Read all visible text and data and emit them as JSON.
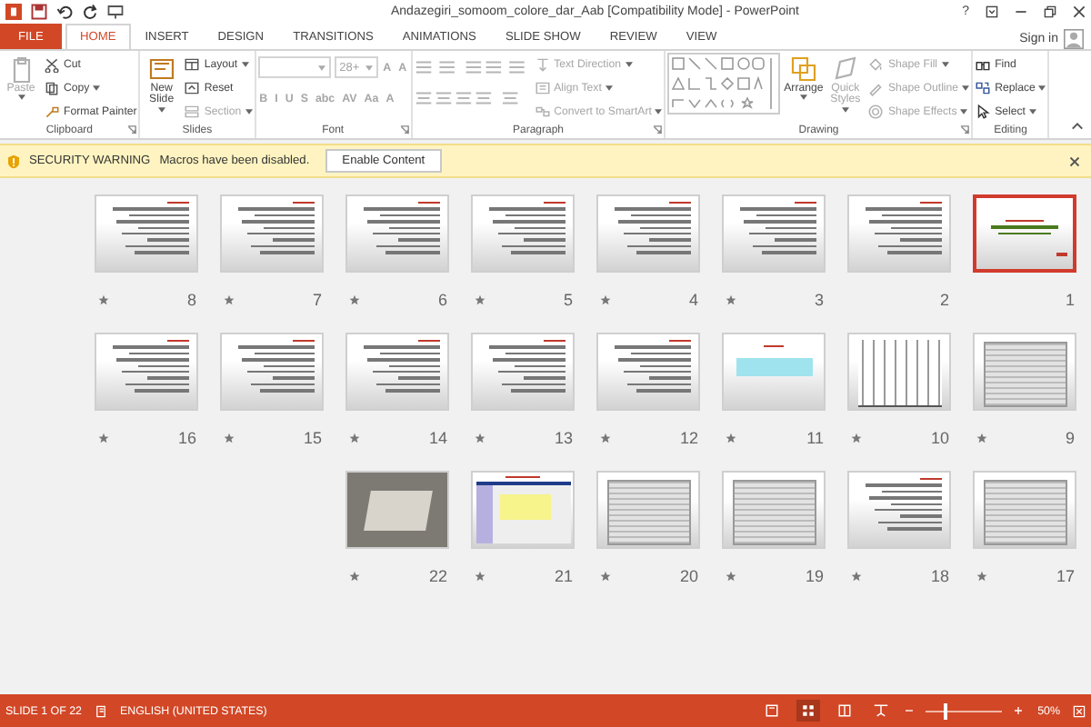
{
  "window": {
    "title": "Andazegiri_somoom_colore_dar_Aab [Compatibility Mode] - PowerPoint",
    "help": "?"
  },
  "tabs": [
    {
      "label": "FILE",
      "kind": "file",
      "selected": false
    },
    {
      "label": "HOME",
      "kind": "tab",
      "selected": true
    },
    {
      "label": "INSERT",
      "kind": "tab",
      "selected": false
    },
    {
      "label": "DESIGN",
      "kind": "tab",
      "selected": false
    },
    {
      "label": "TRANSITIONS",
      "kind": "tab",
      "selected": false
    },
    {
      "label": "ANIMATIONS",
      "kind": "tab",
      "selected": false
    },
    {
      "label": "SLIDE SHOW",
      "kind": "tab",
      "selected": false
    },
    {
      "label": "REVIEW",
      "kind": "tab",
      "selected": false
    },
    {
      "label": "VIEW",
      "kind": "tab",
      "selected": false
    }
  ],
  "account": {
    "label": "Sign in"
  },
  "ribbon": {
    "groups": [
      {
        "label": "Clipboard",
        "launcher": true,
        "columns": [
          [
            {
              "kind": "large",
              "label": "Paste",
              "disabled": true,
              "dropdown": true
            }
          ],
          [
            {
              "kind": "small",
              "label": "Cut",
              "disabled": false,
              "dropdown": false
            },
            {
              "kind": "small",
              "label": "Copy",
              "disabled": false,
              "dropdown": true
            },
            {
              "kind": "small",
              "label": "Format Painter",
              "disabled": false,
              "dropdown": false
            }
          ]
        ]
      },
      {
        "label": "Slides",
        "launcher": false,
        "columns": [
          [
            {
              "kind": "large",
              "label": "New Slide",
              "disabled": false,
              "dropdown": true
            }
          ],
          [
            {
              "kind": "small",
              "label": "Layout",
              "disabled": false,
              "dropdown": true
            },
            {
              "kind": "small",
              "label": "Reset",
              "disabled": false,
              "dropdown": false
            },
            {
              "kind": "small",
              "label": "Section",
              "disabled": true,
              "dropdown": true
            }
          ]
        ]
      },
      {
        "label": "Font",
        "launcher": true,
        "columns": [
          [
            {
              "kind": "row",
              "items": [
                {
                  "kind": "combo",
                  "disabled": true,
                  "dropdown": true
                },
                {
                  "kind": "combo",
                  "value": "28+",
                  "disabled": true,
                  "dropdown": true
                },
                {
                  "kind": "glyph",
                  "label": "A",
                  "disabled": true
                },
                {
                  "kind": "glyph",
                  "label": "A",
                  "disabled": true
                }
              ]
            },
            {
              "kind": "row",
              "items": [
                {
                  "kind": "glyph",
                  "label": "B",
                  "disabled": true
                },
                {
                  "kind": "glyph",
                  "label": "I",
                  "disabled": true
                },
                {
                  "kind": "glyph",
                  "label": "U",
                  "disabled": true
                },
                {
                  "kind": "glyph",
                  "label": "S",
                  "disabled": true
                },
                {
                  "kind": "glyph",
                  "label": "abc",
                  "disabled": true
                },
                {
                  "kind": "glyph",
                  "label": "AV",
                  "disabled": true
                },
                {
                  "kind": "glyph",
                  "label": "Aa",
                  "disabled": true
                },
                {
                  "kind": "glyph",
                  "label": "A",
                  "disabled": true
                }
              ]
            }
          ]
        ]
      },
      {
        "label": "Paragraph",
        "launcher": true,
        "columns": [
          [
            {
              "kind": "listbuttons",
              "disabled": true
            },
            {
              "kind": "alignbuttons",
              "disabled": true
            }
          ],
          [
            {
              "kind": "small",
              "label": "Text Direction",
              "disabled": true,
              "dropdown": true
            },
            {
              "kind": "small",
              "label": "Align Text",
              "disabled": true,
              "dropdown": true
            },
            {
              "kind": "small",
              "label": "Convert to SmartArt",
              "disabled": true,
              "dropdown": true
            }
          ]
        ]
      },
      {
        "label": "Drawing",
        "launcher": true,
        "columns": [
          [
            {
              "kind": "shapes",
              "disabled": true
            }
          ],
          [
            {
              "kind": "large",
              "label": "Arrange",
              "disabled": false,
              "dropdown": true
            }
          ],
          [
            {
              "kind": "large",
              "label": "Quick Styles",
              "disabled": true,
              "dropdown": true
            }
          ],
          [
            {
              "kind": "small",
              "label": "Shape Fill",
              "disabled": true,
              "dropdown": true
            },
            {
              "kind": "small",
              "label": "Shape Outline",
              "disabled": true,
              "dropdown": true
            },
            {
              "kind": "small",
              "label": "Shape Effects",
              "disabled": true,
              "dropdown": true
            }
          ]
        ]
      },
      {
        "label": "Editing",
        "launcher": false,
        "columns": [
          [
            {
              "kind": "small",
              "label": "Find",
              "disabled": false,
              "dropdown": false
            },
            {
              "kind": "small",
              "label": "Replace",
              "disabled": false,
              "dropdown": true
            },
            {
              "kind": "small",
              "label": "Select",
              "disabled": false,
              "dropdown": true
            }
          ]
        ]
      }
    ]
  },
  "security_bar": {
    "title": "SECURITY WARNING",
    "message": "Macros have been disabled.",
    "button": "Enable Content"
  },
  "slide_rows": [
    [
      {
        "number": "8",
        "kind": "text",
        "selected": false,
        "transition": true
      },
      {
        "number": "7",
        "kind": "text",
        "selected": false,
        "transition": true
      },
      {
        "number": "6",
        "kind": "text",
        "selected": false,
        "transition": true
      },
      {
        "number": "5",
        "kind": "text",
        "selected": false,
        "transition": true
      },
      {
        "number": "4",
        "kind": "text",
        "selected": false,
        "transition": true
      },
      {
        "number": "3",
        "kind": "text",
        "selected": false,
        "transition": true
      },
      {
        "number": "2",
        "kind": "text",
        "selected": false,
        "transition": false
      },
      {
        "number": "1",
        "kind": "title",
        "selected": true,
        "transition": false
      }
    ],
    [
      {
        "number": "16",
        "kind": "text",
        "selected": false,
        "transition": true
      },
      {
        "number": "15",
        "kind": "text",
        "selected": false,
        "transition": true
      },
      {
        "number": "14",
        "kind": "text",
        "selected": false,
        "transition": true
      },
      {
        "number": "13",
        "kind": "text",
        "selected": false,
        "transition": true
      },
      {
        "number": "12",
        "kind": "text",
        "selected": false,
        "transition": true
      },
      {
        "number": "11",
        "kind": "equation",
        "selected": false,
        "transition": true
      },
      {
        "number": "10",
        "kind": "chart",
        "selected": false,
        "transition": true
      },
      {
        "number": "9",
        "kind": "table",
        "selected": false,
        "transition": true
      }
    ],
    [
      {
        "number": "22",
        "kind": "photo",
        "selected": false,
        "transition": true
      },
      {
        "number": "21",
        "kind": "screenshot",
        "selected": false,
        "transition": true
      },
      {
        "number": "20",
        "kind": "table",
        "selected": false,
        "transition": true
      },
      {
        "number": "19",
        "kind": "table",
        "selected": false,
        "transition": true
      },
      {
        "number": "18",
        "kind": "text",
        "selected": false,
        "transition": true
      },
      {
        "number": "17",
        "kind": "table",
        "selected": false,
        "transition": true
      }
    ]
  ],
  "status_bar": {
    "slide": "SLIDE 1 OF 22",
    "language": "ENGLISH (UNITED STATES)",
    "views": [
      {
        "selected": false
      },
      {
        "selected": true
      },
      {
        "selected": false
      },
      {
        "selected": false
      }
    ],
    "zoom": {
      "level": 0.28,
      "reading": "50%"
    }
  }
}
